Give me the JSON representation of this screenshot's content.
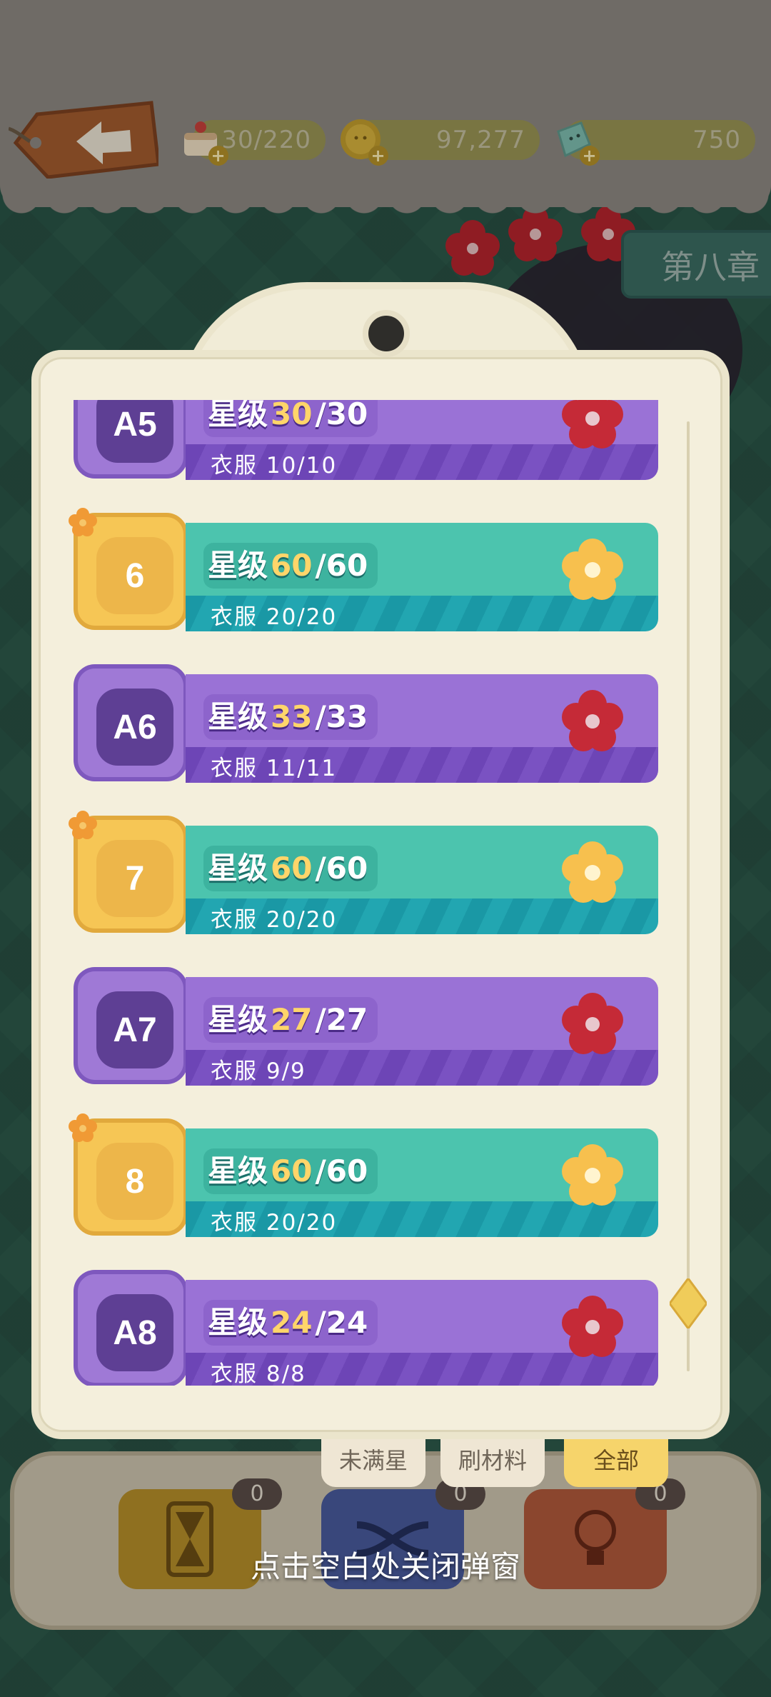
{
  "resources": [
    {
      "name": "cake",
      "value": "30/220",
      "icon": "cake-icon"
    },
    {
      "name": "coin",
      "value": "97,277",
      "icon": "coin-icon"
    },
    {
      "name": "gem",
      "value": "750",
      "icon": "gem-icon"
    }
  ],
  "chapter": {
    "label": "第八章"
  },
  "levels": [
    {
      "id": "A5",
      "type": "purple",
      "stars_prefix": "星级",
      "stars_current": "30",
      "stars_total": "/30",
      "clothes": "衣服 10/10",
      "flower": "red-flower-icon"
    },
    {
      "id": "6",
      "type": "teal",
      "stars_prefix": "星级",
      "stars_current": "60",
      "stars_total": "/60",
      "clothes": "衣服 20/20",
      "flower": "yellow-flower-icon"
    },
    {
      "id": "A6",
      "type": "purple",
      "stars_prefix": "星级",
      "stars_current": "33",
      "stars_total": "/33",
      "clothes": "衣服 11/11",
      "flower": "red-flower-icon"
    },
    {
      "id": "7",
      "type": "teal",
      "stars_prefix": "星级",
      "stars_current": "60",
      "stars_total": "/60",
      "clothes": "衣服 20/20",
      "flower": "yellow-flower-icon"
    },
    {
      "id": "A7",
      "type": "purple",
      "stars_prefix": "星级",
      "stars_current": "27",
      "stars_total": "/27",
      "clothes": "衣服 9/9",
      "flower": "red-flower-icon"
    },
    {
      "id": "8",
      "type": "teal",
      "stars_prefix": "星级",
      "stars_current": "60",
      "stars_total": "/60",
      "clothes": "衣服 20/20",
      "flower": "yellow-flower-icon"
    },
    {
      "id": "A8",
      "type": "purple",
      "stars_prefix": "星级",
      "stars_current": "24",
      "stars_total": "/24",
      "clothes": "衣服 8/8",
      "flower": "red-flower-icon"
    }
  ],
  "filters": [
    {
      "label": "未满星",
      "active": false
    },
    {
      "label": "刷材料",
      "active": false
    },
    {
      "label": "全部",
      "active": true
    }
  ],
  "tools": [
    {
      "name": "hourglass",
      "icon": "hourglass-icon",
      "count": "0",
      "color": "#b8902a"
    },
    {
      "name": "shuffle",
      "icon": "shuffle-icon",
      "count": "0",
      "color": "#4a5c9e"
    },
    {
      "name": "hint",
      "icon": "lightbulb-icon",
      "count": "0",
      "color": "#b35a3c"
    }
  ],
  "hint_text": "点击空白处关闭弹窗"
}
